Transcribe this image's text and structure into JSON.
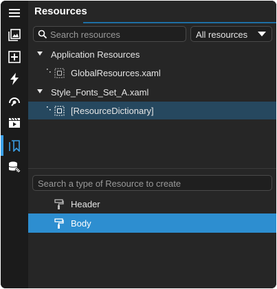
{
  "colors": {
    "accent": "#3aa0e8",
    "selected_tree_row": "#26485f",
    "selected_list_row": "#2d8ed0",
    "panel_bg": "#262626",
    "activity_bg": "#1b1b1b"
  },
  "activity_bar": {
    "items": [
      {
        "icon": "hamburger-menu-icon"
      },
      {
        "icon": "gallery-icon"
      },
      {
        "icon": "add-box-icon"
      },
      {
        "icon": "lightning-icon"
      },
      {
        "icon": "gauge-icon"
      },
      {
        "icon": "media-clapper-icon"
      },
      {
        "icon": "resources-bookmark-icon",
        "active": true
      },
      {
        "icon": "database-link-icon"
      }
    ]
  },
  "panel": {
    "title": "Resources",
    "search": {
      "placeholder": "Search resources",
      "value": ""
    },
    "filter": {
      "selected": "All resources"
    }
  },
  "tree": [
    {
      "label": "Application Resources",
      "expanded": true,
      "children": [
        {
          "label": "GlobalResources.xaml",
          "selected": false
        }
      ]
    },
    {
      "label": "Style_Fonts_Set_A.xaml",
      "expanded": true,
      "children": [
        {
          "label": "[ResourceDictionary]",
          "selected": true
        }
      ]
    }
  ],
  "create": {
    "placeholder": "Search a type of Resource to create",
    "types": [
      {
        "label": "Header",
        "icon": "paint-roller-icon",
        "selected": false
      },
      {
        "label": "Body",
        "icon": "paint-roller-icon",
        "selected": true
      }
    ]
  }
}
